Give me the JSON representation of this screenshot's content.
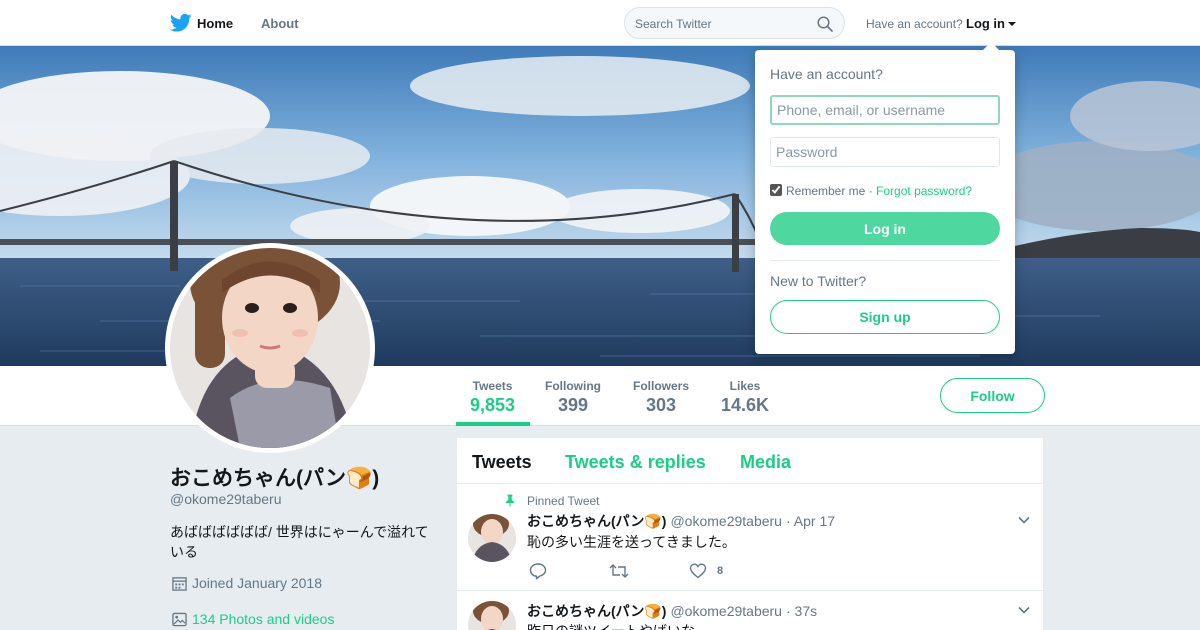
{
  "nav": {
    "home_label": "Home",
    "about_label": "About",
    "search_placeholder": "Search Twitter",
    "have_account_text": "Have an account?",
    "login_label": "Log in"
  },
  "profile": {
    "name": "おこめちゃん(パン🍞)",
    "handle": "@okome29taberu",
    "bio": "あばばばばばば/ 世界はにゃーんで溢れている",
    "joined": "Joined January 2018",
    "photos": "134 Photos and videos",
    "follow_label": "Follow"
  },
  "stats": [
    {
      "label": "Tweets",
      "value": "9,853"
    },
    {
      "label": "Following",
      "value": "399"
    },
    {
      "label": "Followers",
      "value": "303"
    },
    {
      "label": "Likes",
      "value": "14.6K"
    }
  ],
  "timeline": {
    "tabs": [
      "Tweets",
      "Tweets & replies",
      "Media"
    ],
    "tweets": [
      {
        "pinned_label": "Pinned Tweet",
        "name": "おこめちゃん(パン🍞)",
        "handle": "@okome29taberu",
        "time": "· Apr 17",
        "text": "恥の多い生涯を送ってきました。",
        "likes": "8"
      },
      {
        "name": "おこめちゃん(パン🍞)",
        "handle": "@okome29taberu",
        "time": "· 37s",
        "text": "昨日の謎ツイートやばいな"
      }
    ]
  },
  "login_dropdown": {
    "heading": "Have an account?",
    "username_placeholder": "Phone, email, or username",
    "password_placeholder": "Password",
    "remember_label": "Remember me",
    "separator": "·",
    "forgot_label": "Forgot password?",
    "login_button": "Log in",
    "new_to_twitter": "New to Twitter?",
    "signup_button": "Sign up"
  },
  "colors": {
    "accent": "#19cf86",
    "login_button": "#4ed8a0",
    "muted_text": "#657786",
    "background": "#e6ecf0"
  },
  "icons": [
    "twitter-bird-icon",
    "search-icon",
    "caret-down-icon",
    "calendar-icon",
    "image-icon",
    "pin-icon",
    "reply-icon",
    "retweet-icon",
    "like-icon",
    "chevron-down-icon"
  ]
}
